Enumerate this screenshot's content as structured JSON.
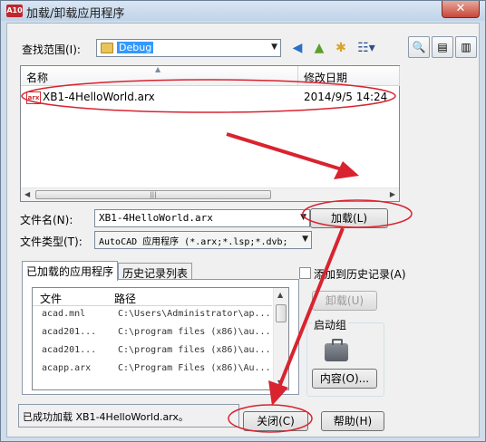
{
  "window": {
    "title": "加载/卸载应用程序",
    "app_icon_text": "A10",
    "close_symbol": "✕"
  },
  "lookin": {
    "label": "查找范围(I):",
    "value": "Debug"
  },
  "toolbar": {
    "back": "◀",
    "up": "▲",
    "newfolder": "✱",
    "views": "☷▾"
  },
  "rightbar": {
    "find": "🔍",
    "tools1": "▤",
    "tools2": "▥"
  },
  "filelist": {
    "col_name": "名称",
    "col_date": "修改日期",
    "rows": [
      {
        "name": "XB1-4HelloWorld.arx",
        "date": "2014/9/5 14:24",
        "icon": "arx"
      }
    ]
  },
  "filename": {
    "label": "文件名(N):",
    "value": "XB1-4HelloWorld.arx"
  },
  "filetype": {
    "label": "文件类型(T):",
    "value": "AutoCAD 应用程序 (*.arx;*.lsp;*.dvb;"
  },
  "load_button": "加载(L)",
  "tabs": {
    "loaded": "已加载的应用程序",
    "history": "历史记录列表"
  },
  "applist": {
    "col_file": "文件",
    "col_path": "路径",
    "rows": [
      {
        "file": "acad.mnl",
        "path": "C:\\Users\\Administrator\\ap..."
      },
      {
        "file": "acad201...",
        "path": "C:\\program files (x86)\\au..."
      },
      {
        "file": "acad201...",
        "path": "C:\\program files (x86)\\au..."
      },
      {
        "file": "acapp.arx",
        "path": "C:\\Program Files (x86)\\Au..."
      }
    ]
  },
  "add_history_label": "添加到历史记录(A)",
  "unload_button": "卸载(U)",
  "startup": {
    "label": "启动组",
    "contents_button": "内容(O)..."
  },
  "status_text": "已成功加载 XB1-4HelloWorld.arx。",
  "close_button": "关闭(C)",
  "help_button": "帮助(H)",
  "annotation_color": "#d9232f"
}
